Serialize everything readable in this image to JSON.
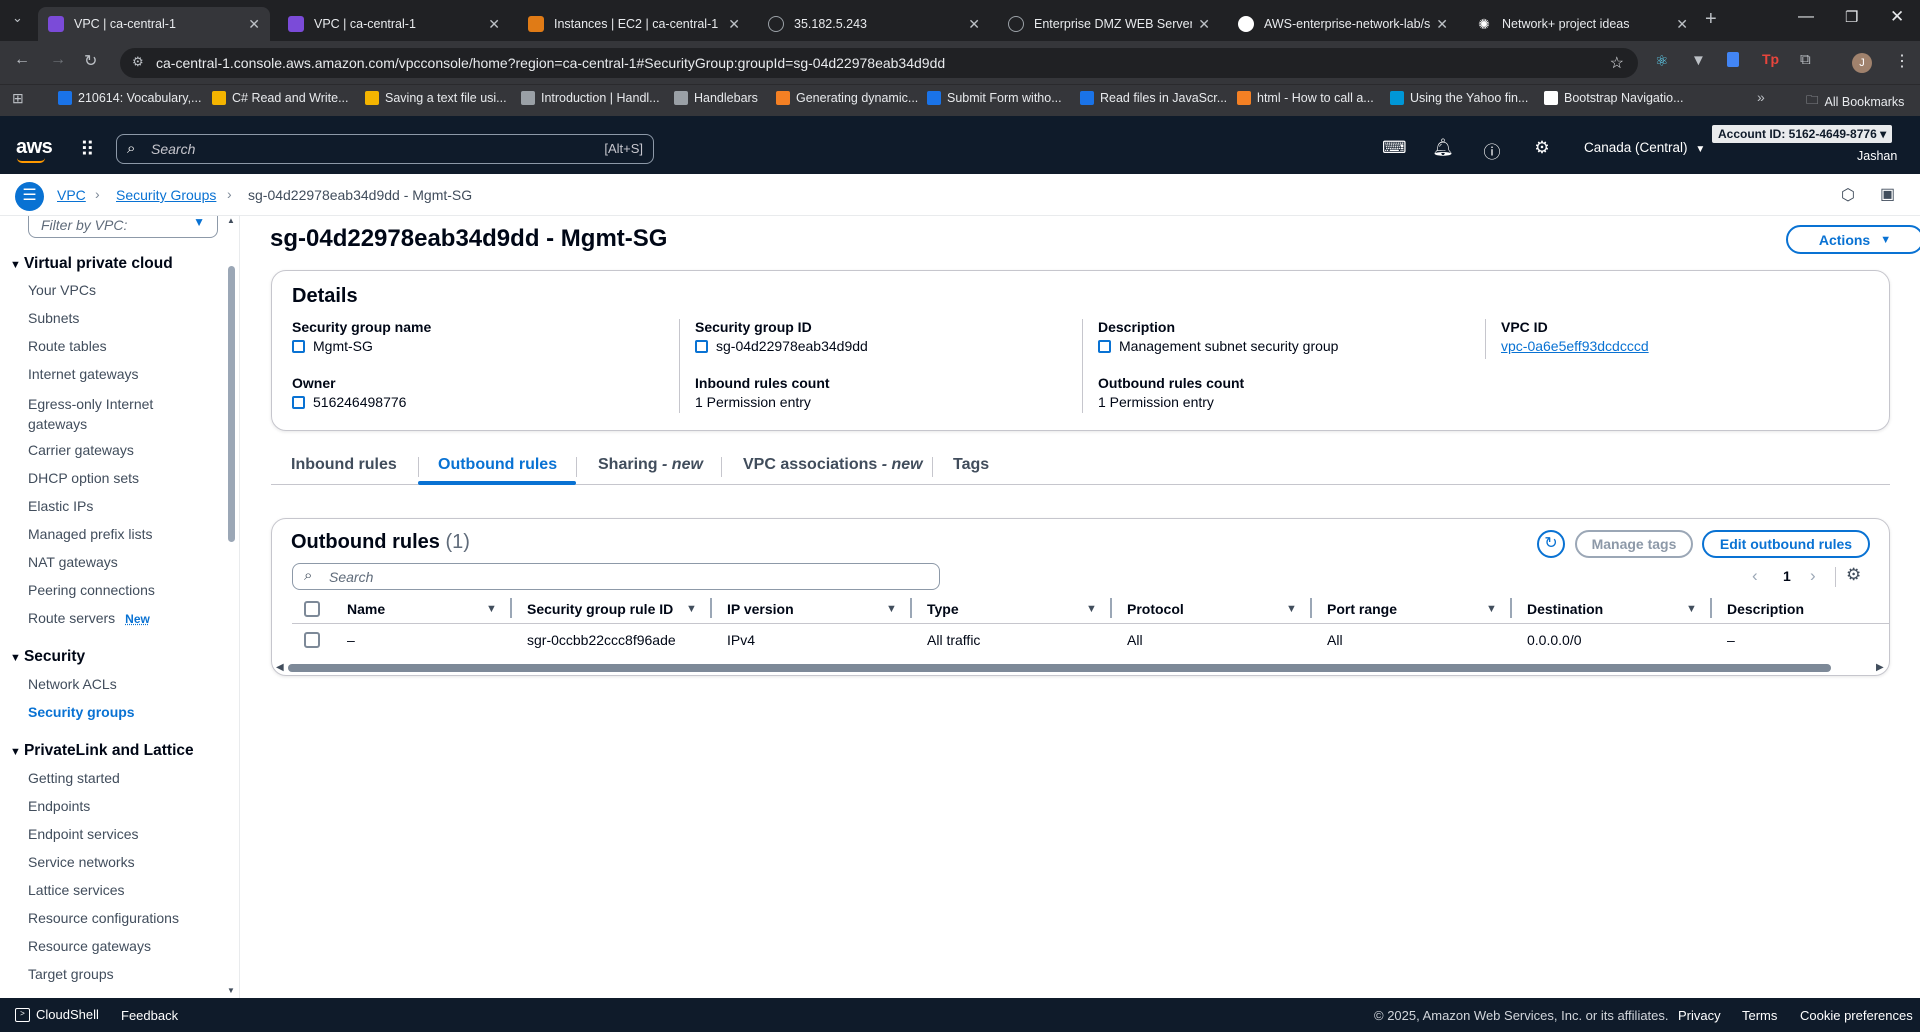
{
  "browser": {
    "tabs": [
      {
        "title": "VPC | ca-central-1",
        "active": true,
        "icon": "vpc-icon",
        "color": "#7b4bd8"
      },
      {
        "title": "VPC | ca-central-1",
        "active": false,
        "icon": "vpc-icon",
        "color": "#7b4bd8"
      },
      {
        "title": "Instances | EC2 | ca-central-1",
        "active": false,
        "icon": "ec2-icon",
        "color": "#e07b16"
      },
      {
        "title": "35.182.5.243",
        "active": false,
        "icon": "globe-icon",
        "color": "#9aa0a6"
      },
      {
        "title": "Enterprise DMZ WEB Server",
        "active": false,
        "icon": "globe-icon",
        "color": "#9aa0a6"
      },
      {
        "title": "AWS-enterprise-network-lab/s",
        "active": false,
        "icon": "github-icon",
        "color": "#ffffff"
      },
      {
        "title": "Network+ project ideas",
        "active": false,
        "icon": "chatgpt-icon",
        "color": "#ffffff"
      }
    ],
    "url": "ca-central-1.console.aws.amazon.com/vpcconsole/home?region=ca-central-1#SecurityGroup:groupId=sg-04d22978eab34d9dd",
    "bookmarks": [
      {
        "label": "210614: Vocabulary,...",
        "color": "#1a73e8"
      },
      {
        "label": "C# Read and Write...",
        "color": "#f4b400"
      },
      {
        "label": "Saving a text file usi...",
        "color": "#f4b400"
      },
      {
        "label": "Introduction | Handl...",
        "color": "#9aa0a6"
      },
      {
        "label": "Handlebars",
        "color": "#9aa0a6"
      },
      {
        "label": "Generating dynamic...",
        "color": "#f48024"
      },
      {
        "label": "Submit Form witho...",
        "color": "#1a73e8"
      },
      {
        "label": "Read files in JavaScr...",
        "color": "#1a73e8"
      },
      {
        "label": "html - How to call a...",
        "color": "#f48024"
      },
      {
        "label": "Using the Yahoo fin...",
        "color": "#0097d7"
      },
      {
        "label": "Bootstrap Navigatio...",
        "color": "#ffffff"
      }
    ],
    "all_bookmarks": "All Bookmarks"
  },
  "aws": {
    "search_placeholder": "Search",
    "search_shortcut": "[Alt+S]",
    "region": "Canada (Central)",
    "account": "Account ID: 5162-4649-8776",
    "user": "Jashan"
  },
  "breadcrumb": {
    "vpc": "VPC",
    "security_groups": "Security Groups",
    "current": "sg-04d22978eab34d9dd - Mgmt-SG"
  },
  "sidebar": {
    "filter_placeholder": "Filter by VPC:",
    "sections": [
      {
        "title": "Virtual private cloud",
        "items": [
          "Your VPCs",
          "Subnets",
          "Route tables",
          "Internet gateways",
          "Egress-only Internet gateways",
          "Carrier gateways",
          "DHCP option sets",
          "Elastic IPs",
          "Managed prefix lists",
          "NAT gateways",
          "Peering connections",
          "Route servers"
        ]
      },
      {
        "title": "Security",
        "items": [
          "Network ACLs",
          "Security groups"
        ]
      },
      {
        "title": "PrivateLink and Lattice",
        "items": [
          "Getting started",
          "Endpoints",
          "Endpoint services",
          "Service networks",
          "Lattice services",
          "Resource configurations",
          "Resource gateways",
          "Target groups"
        ]
      }
    ],
    "new_badge": "New"
  },
  "page": {
    "title": "sg-04d22978eab34d9dd - Mgmt-SG",
    "actions": "Actions"
  },
  "details": {
    "heading": "Details",
    "sg_name_label": "Security group name",
    "sg_name": "Mgmt-SG",
    "sg_id_label": "Security group ID",
    "sg_id": "sg-04d22978eab34d9dd",
    "desc_label": "Description",
    "desc": "Management subnet security group",
    "vpc_label": "VPC ID",
    "vpc": "vpc-0a6e5eff93dcdcccd",
    "owner_label": "Owner",
    "owner": "516246498776",
    "inbound_label": "Inbound rules count",
    "inbound": "1 Permission entry",
    "outbound_label": "Outbound rules count",
    "outbound": "1 Permission entry"
  },
  "tabs": {
    "inbound": "Inbound rules",
    "outbound": "Outbound rules",
    "sharing": "Sharing",
    "vpc_assoc": "VPC associations",
    "new": "- new",
    "tags": "Tags"
  },
  "rules": {
    "heading": "Outbound rules",
    "count": "(1)",
    "manage_tags": "Manage tags",
    "edit": "Edit outbound rules",
    "search_placeholder": "Search",
    "page": "1",
    "columns": [
      "Name",
      "Security group rule ID",
      "IP version",
      "Type",
      "Protocol",
      "Port range",
      "Destination",
      "Description"
    ],
    "rows": [
      [
        "–",
        "sgr-0ccbb22ccc8f96ade",
        "IPv4",
        "All traffic",
        "All",
        "All",
        "0.0.0.0/0",
        "–"
      ]
    ]
  },
  "footer": {
    "cloudshell": "CloudShell",
    "feedback": "Feedback",
    "copyright": "© 2025, Amazon Web Services, Inc. or its affiliates.",
    "privacy": "Privacy",
    "terms": "Terms",
    "cookies": "Cookie preferences"
  }
}
